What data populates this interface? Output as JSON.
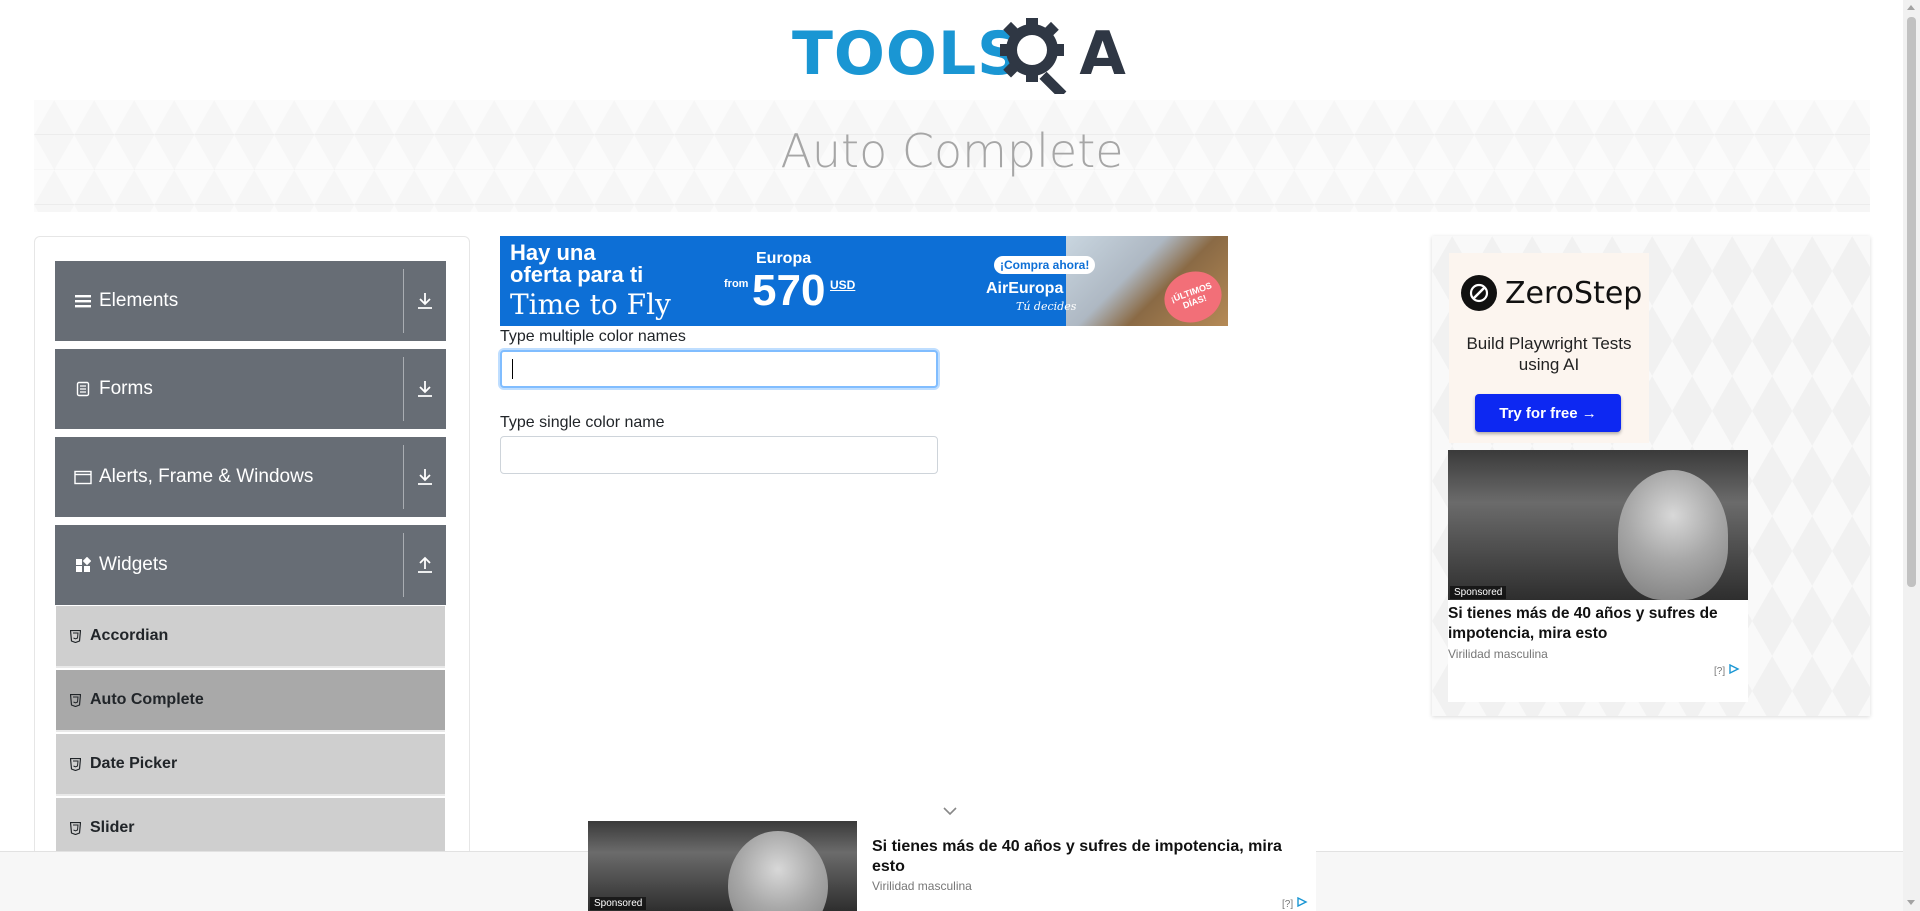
{
  "logo": {
    "text_left": "TOOLS",
    "text_right": "A"
  },
  "page_title": "Auto Complete",
  "sidebar": {
    "groups": [
      {
        "label": "Elements",
        "icon": "hamburger-icon",
        "state": "collapsed"
      },
      {
        "label": "Forms",
        "icon": "document-icon",
        "state": "collapsed"
      },
      {
        "label": "Alerts, Frame & Windows",
        "icon": "window-icon",
        "state": "collapsed"
      },
      {
        "label": "Widgets",
        "icon": "widgets-icon",
        "state": "expanded"
      }
    ],
    "widget_items": [
      {
        "label": "Accordian",
        "active": false
      },
      {
        "label": "Auto Complete",
        "active": true
      },
      {
        "label": "Date Picker",
        "active": false
      },
      {
        "label": "Slider",
        "active": false
      }
    ]
  },
  "ad_top": {
    "line1": "Hay una",
    "line2": "oferta para ti",
    "line3": "Time to Fly",
    "destination": "Europa",
    "from_label": "from",
    "price": "570",
    "currency": "USD",
    "cta": "¡Compra ahora!",
    "brand": "AirEuropa",
    "brand_tagline": "Tú decides",
    "badge": "¡ÚLTIMOS DÍAS!",
    "brand_color": "#0d6fd6"
  },
  "form": {
    "multi_label": "Type multiple color names",
    "multi_value": "",
    "single_label": "Type single color name",
    "single_value": ""
  },
  "ad_right": {
    "brand": "ZeroStep",
    "tagline": "Build Playwright Tests using AI",
    "button": "Try for free →",
    "sponsored_tag": "Sponsored",
    "sponsored_title": "Si tienes más de 40 años y sufres de impotencia, mira esto",
    "sponsored_source": "Virilidad masculina",
    "adchoice": "[?]",
    "button_color": "#0d28f2"
  },
  "ad_bottom": {
    "sponsored_tag": "Sponsored",
    "title": "Si tienes más de 40 años y sufres de impotencia, mira esto",
    "source": "Virilidad masculina",
    "adchoice": "[?]"
  },
  "colors": {
    "sidebar_header": "#676d75",
    "sidebar_item": "#cfcfcf",
    "sidebar_item_active": "#a9a9a9",
    "logo_blue": "#1a96d3",
    "logo_dark": "#2f3744"
  }
}
